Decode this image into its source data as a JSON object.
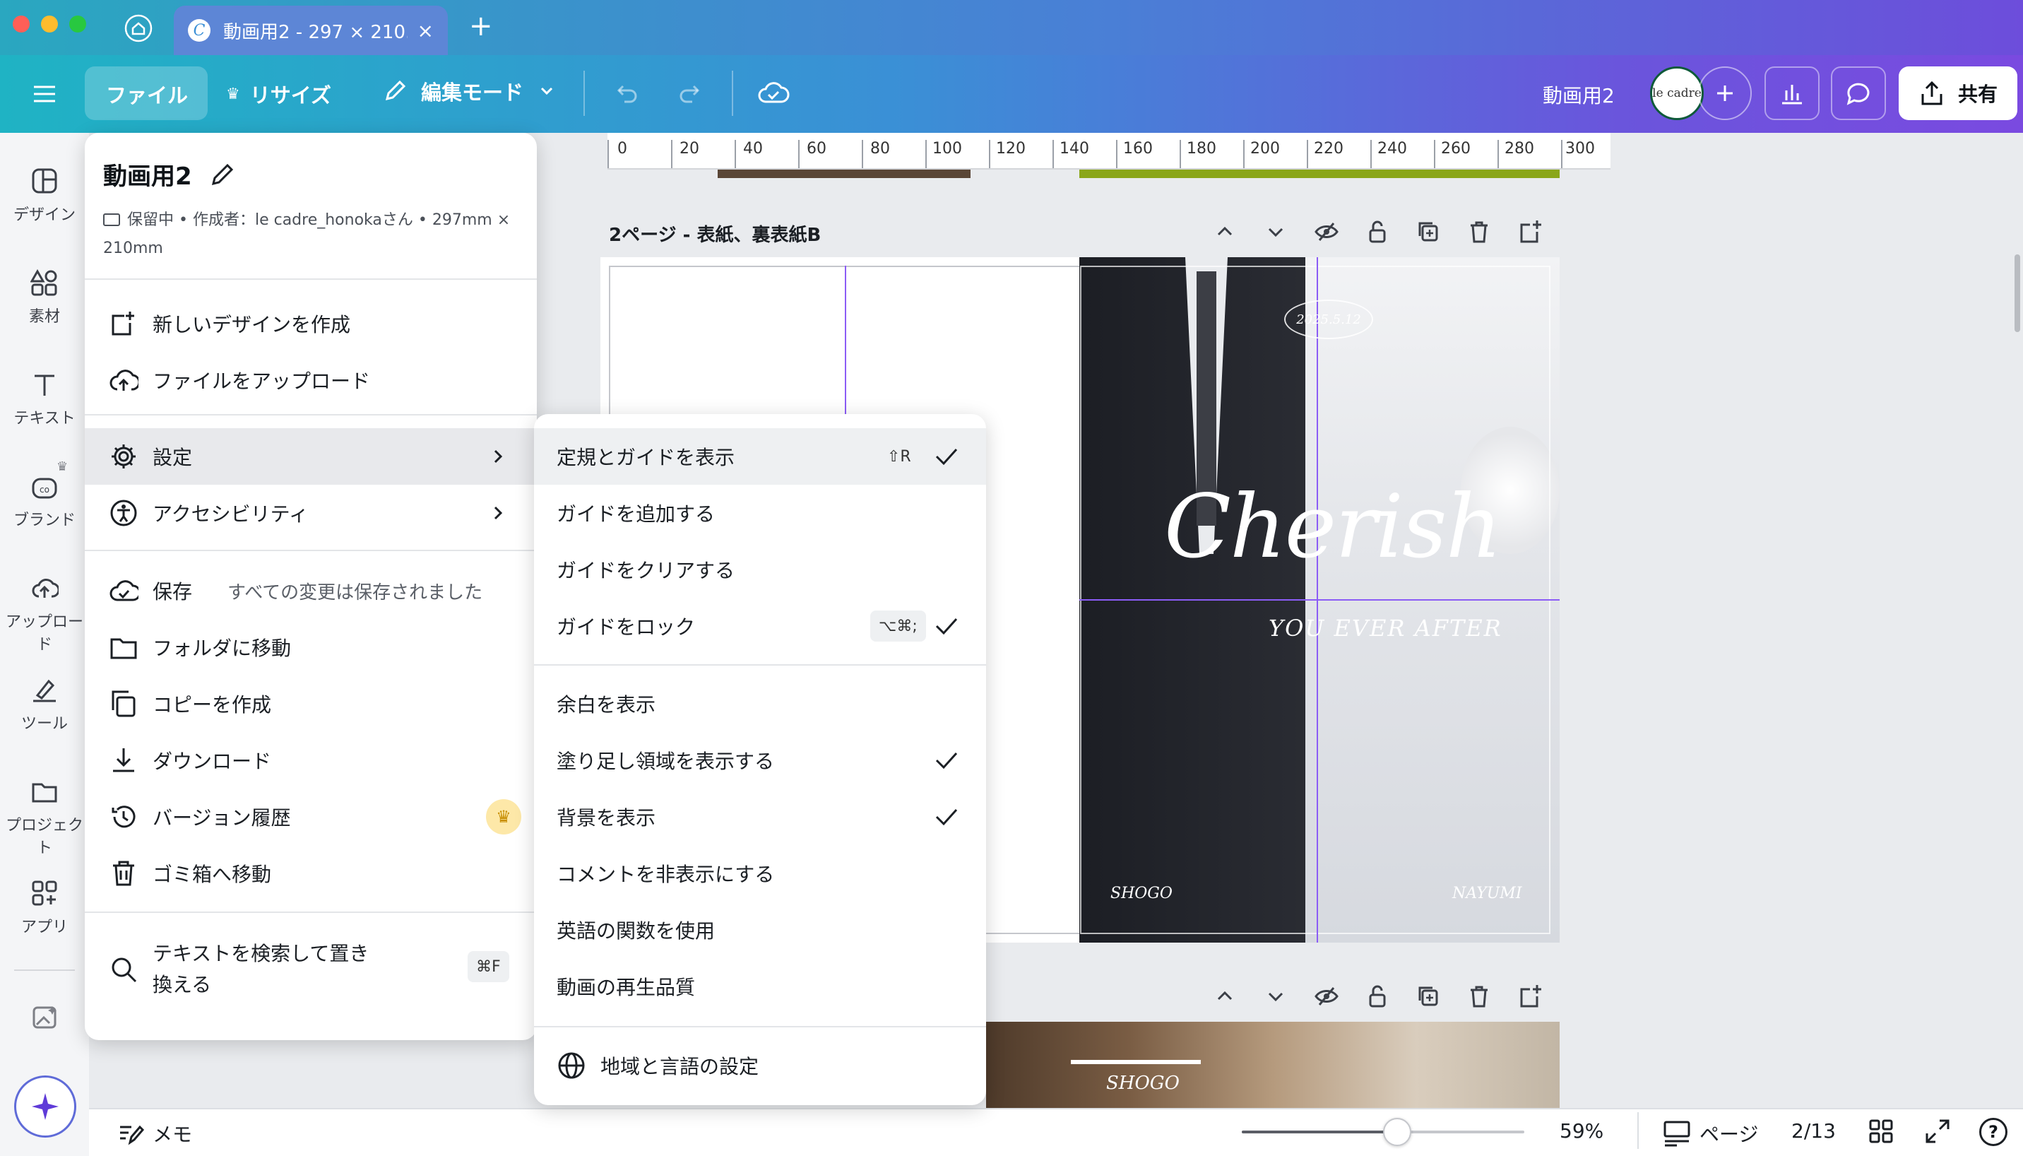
{
  "titlebar": {
    "tab_title": "動画用2 - 297 × 210...",
    "home_icon": "home-icon",
    "new_tab_label": "+"
  },
  "toolbar": {
    "file_label": "ファイル",
    "resize_label": "リサイズ",
    "edit_mode_label": "編集モード",
    "design_name": "動画用2",
    "avatar_text": "le cadre",
    "share_label": "共有"
  },
  "sidebar": {
    "items": [
      {
        "label": "デザイン",
        "icon": "layout-icon"
      },
      {
        "label": "素材",
        "icon": "elements-icon"
      },
      {
        "label": "テキスト",
        "icon": "text-icon"
      },
      {
        "label": "ブランド",
        "icon": "brand-icon"
      },
      {
        "label": "アップロード",
        "icon": "upload-icon"
      },
      {
        "label": "ツール",
        "icon": "tool-icon"
      },
      {
        "label": "プロジェクト",
        "icon": "folder-icon"
      },
      {
        "label": "アプリ",
        "icon": "apps-icon"
      }
    ]
  },
  "ruler": {
    "ticks": [
      "0",
      "20",
      "40",
      "60",
      "80",
      "100",
      "120",
      "140",
      "160",
      "180",
      "200",
      "220",
      "240",
      "260",
      "280",
      "300"
    ]
  },
  "page2": {
    "title": "2ページ - 表紙、裏表紙B",
    "date_text": "2025.5.12",
    "script_text": "Cherish",
    "subtitle_text": "YOU EVER AFTER",
    "left_name": "SHOGO",
    "right_name": "NAYUMI"
  },
  "page3": {
    "name_text": "SHOGO"
  },
  "file_menu": {
    "design_title": "動画用2",
    "meta": "保留中 • 作成者：le cadre_honokaさん • 297mm × 210mm",
    "items": {
      "new_design": "新しいデザインを作成",
      "upload": "ファイルをアップロード",
      "settings": "設定",
      "accessibility": "アクセシビリティ",
      "save": "保存",
      "save_status": "すべての変更は保存されました",
      "move_folder": "フォルダに移動",
      "make_copy": "コピーを作成",
      "download": "ダウンロード",
      "version_history": "バージョン履歴",
      "trash": "ゴミ箱へ移動",
      "find_replace": "テキストを検索して置き換える",
      "find_shortcut": "⌘F"
    }
  },
  "settings_menu": {
    "items": {
      "show_rulers": "定規とガイドを表示",
      "show_rulers_shortcut": "⇧R",
      "add_guide": "ガイドを追加する",
      "clear_guides": "ガイドをクリアする",
      "lock_guides": "ガイドをロック",
      "lock_guides_shortcut": "⌥⌘;",
      "show_margins": "余白を表示",
      "show_bleed": "塗り足し領域を表示する",
      "show_background": "背景を表示",
      "hide_comments": "コメントを非表示にする",
      "english_functions": "英語の関数を使用",
      "video_quality": "動画の再生品質",
      "region_language": "地域と言語の設定"
    }
  },
  "bottombar": {
    "notes_label": "メモ",
    "zoom_percent": "59%",
    "zoom_level": 0.55,
    "pages_label": "ページ",
    "page_counter": "2/13"
  },
  "colors": {
    "accent_purple": "#7d2ae8",
    "guide_purple": "#8b5cf6",
    "lime_strip": "#8aa61a",
    "crown_gold": "#f5b800"
  }
}
